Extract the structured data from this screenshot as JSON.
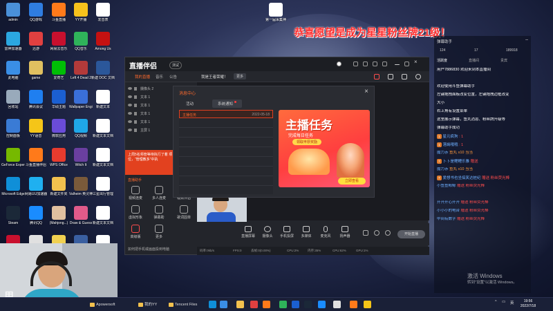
{
  "banner": "恭喜愿望是成为星星粉丝牌21级！",
  "desktop_icons": [
    {
      "label": "admin",
      "color": "#4a90d9"
    },
    {
      "label": "QQ游戏",
      "color": "#2f7de0"
    },
    {
      "label": "斗鱼直播",
      "color": "#ff7a1a"
    },
    {
      "label": "YY开播",
      "color": "#f7c21c"
    },
    {
      "label": "发音表",
      "color": "#ffffff"
    },
    {
      "label": "雷神加速器",
      "color": "#2ba7e0"
    },
    {
      "label": "迅游",
      "color": "#e04040"
    },
    {
      "label": "网易云音乐",
      "color": "#c8102e"
    },
    {
      "label": "QQ音乐",
      "color": "#2fb35a"
    },
    {
      "label": "Among Us",
      "color": "#c51111"
    },
    {
      "label": "此电脑",
      "color": "#3a8ee6"
    },
    {
      "label": "game",
      "color": "#e0c060"
    },
    {
      "label": "爱奇艺",
      "color": "#00be06"
    },
    {
      "label": "Left 4 Dead 2",
      "color": "#b33a3a"
    },
    {
      "label": "新建 DOC 文档",
      "color": "#2b579a"
    },
    {
      "label": "回收站",
      "color": "#9ab"
    },
    {
      "label": "腾讯会议",
      "color": "#1f7ff0"
    },
    {
      "label": "华硕主题",
      "color": "#1b5fd1"
    },
    {
      "label": "Wallpaper Engine",
      "color": "#3a6fd8"
    },
    {
      "label": "新建文本",
      "color": "#ffffff"
    },
    {
      "label": "控制面板",
      "color": "#3a7bd5"
    },
    {
      "label": "YY语音",
      "color": "#f5c518"
    },
    {
      "label": "微软应用",
      "color": "#6a4cd8"
    },
    {
      "label": "QQ视频",
      "color": "#1fa7e8"
    },
    {
      "label": "新建文本文档",
      "color": "#ffffff"
    },
    {
      "label": "GeForce Experience",
      "color": "#76b900"
    },
    {
      "label": "斗鱼直播伴侣",
      "color": "#ff7a1a"
    },
    {
      "label": "WPS Office",
      "color": "#e63b2e"
    },
    {
      "label": "Witch It",
      "color": "#6a3fa0"
    },
    {
      "label": "新建文本文档",
      "color": "#ffffff"
    },
    {
      "label": "Microsoft Edge",
      "color": "#0f8fd8"
    },
    {
      "label": "网易UU加速器",
      "color": "#1fb0f0"
    },
    {
      "label": "新建文件夹",
      "color": "#f2c14e"
    },
    {
      "label": "Valheim 英灵神殿",
      "color": "#7a5a3a"
    },
    {
      "label": "三星出行管理",
      "color": "#ffffff"
    },
    {
      "label": "Steam",
      "color": "#1b2838"
    },
    {
      "label": "腾讯QQ",
      "color": "#1a8cff"
    },
    {
      "label": "(Mahjong...)",
      "color": "#e0c0a0"
    },
    {
      "label": "Draw & Guess",
      "color": "#e05a8a"
    },
    {
      "label": "新建文本文档",
      "color": "#ffffff"
    },
    {
      "label": "网易云",
      "color": "#c8102e"
    },
    {
      "label": "",
      "color": "#e0e0e0"
    },
    {
      "label": "",
      "color": "#f0d050"
    },
    {
      "label": "",
      "color": "#3a5fa0"
    },
    {
      "label": "",
      "color": "#ffffff"
    }
  ],
  "recycle_icon": {
    "label": "第一届采集神",
    "color": "#ffffff"
  },
  "app": {
    "logo": "直播伴侣",
    "logo_badge": "测试",
    "tabs": [
      "我的直播",
      "音乐",
      "公告"
    ],
    "notice": "我是王者荣耀！",
    "notice_btn": "更多",
    "scenes": [
      {
        "label": "摄像头 2"
      },
      {
        "label": "文本 1"
      },
      {
        "label": "文本 1"
      },
      {
        "label": "文本 1"
      },
      {
        "label": "文本 1"
      },
      {
        "label": "主屏 1"
      }
    ],
    "promo_text": "上周5名师管等待执行了着 项位，“管理教多”中执",
    "assist_label": "直播助手",
    "tools": [
      {
        "label": "视频连麦"
      },
      {
        "label": "多人连麦"
      },
      {
        "label": "视频伴侣"
      },
      {
        "label": "虚拟形象"
      },
      {
        "label": "弹幕助"
      },
      {
        "label": "歌词固单"
      },
      {
        "label": "高级版"
      },
      {
        "label": "更多"
      }
    ],
    "collapse_label": "如何把手机或画面投到电脑",
    "controls": [
      {
        "label": "直播屏幕"
      },
      {
        "label": "摄像头"
      },
      {
        "label": "手机投屏"
      },
      {
        "label": "多媒体"
      },
      {
        "label": "麦克风"
      },
      {
        "label": "扬声器"
      }
    ],
    "start_btn": "开始直播",
    "status": [
      "码率:0kb/s",
      "FPS:0",
      "丢帧:0(0.00%)",
      "CPU:2%",
      "内存:35%",
      "CPU:62%",
      "GPU:1%"
    ]
  },
  "dialog": {
    "title": "消息中心",
    "tabs": [
      "活动",
      "系统通知"
    ],
    "messages": [
      {
        "name": "主播任务",
        "date": "2022-05-18"
      },
      {
        "name": "",
        "date": ""
      },
      {
        "name": "",
        "date": ""
      },
      {
        "name": "",
        "date": ""
      },
      {
        "name": "",
        "date": ""
      },
      {
        "name": "",
        "date": ""
      },
      {
        "name": "",
        "date": ""
      },
      {
        "name": "",
        "date": ""
      }
    ],
    "card_title": "主播任务",
    "card_sub": "完成每日任务",
    "card_pill": "领取丰厚奖励",
    "card_btn": "立即查看"
  },
  "chat": {
    "header": "弹幕助手",
    "stats": [
      "124",
      "17",
      "189918"
    ],
    "tabs": [
      "活跃度",
      "直播间",
      "贵宾"
    ],
    "lines": [
      {
        "badge": "",
        "user": "",
        "text": "用户7886830 欢迎来到本直播间",
        "cls": "u-white"
      },
      {
        "badge": "",
        "user": "",
        "text": "",
        "cls": "u-white"
      },
      {
        "badge": "",
        "user": "",
        "text": "欢迎使用斗鱼弹幕助手",
        "cls": "u-white"
      },
      {
        "badge": "",
        "user": "",
        "text": "左键拖拽面板改变位置，左键拖拽边框改变",
        "cls": "u-white"
      },
      {
        "badge": "",
        "user": "",
        "text": "大小",
        "cls": "u-white"
      },
      {
        "badge": "",
        "user": "",
        "text": "右上角有设置菜单",
        "cls": "u-white"
      },
      {
        "badge": "",
        "user": "",
        "text": "这里展示弹幕，鱼丸消息、粉丝牌升级等",
        "cls": "u-white"
      },
      {
        "badge": "",
        "user": "",
        "text": "弹幕助手成功",
        "cls": "u-white"
      },
      {
        "badge": "1",
        "user": "星元疯狗",
        "text": ": 1",
        "cls": "u-red"
      },
      {
        "badge": "1",
        "user": "落嫣哦哦",
        "text": ": 1",
        "cls": "u-red"
      },
      {
        "badge": "",
        "user": "魔力赤",
        "text": "鱼丸 x10 当当",
        "cls": "u-orange"
      },
      {
        "badge": "7",
        "user": "卜卜是鲤鲤乐雅",
        "text": "赠送",
        "cls": "u-red"
      },
      {
        "badge": "",
        "user": "魔力赤",
        "text": "鱼丸 x10 当当",
        "cls": "u-orange"
      },
      {
        "badge": "7",
        "user": "爱想书也坐搞笑达桩纪",
        "text": "赠送 粉丝荧光棒",
        "cls": "u-red"
      },
      {
        "badge": "",
        "user": "小鱼鱼鲸鲸",
        "text": "赠送 粉丝荧光棒",
        "cls": "u-red"
      },
      {
        "badge": "",
        "user": "",
        "text": "",
        "cls": "u-white"
      },
      {
        "badge": "",
        "user": "开开开心开开",
        "text": "赠送 粉丝荧光棒",
        "cls": "u-red"
      },
      {
        "badge": "",
        "user": "小小小的电台",
        "text": "赠送 粉丝荧光棒",
        "cls": "u-red"
      },
      {
        "badge": "",
        "user": "中间有数字",
        "text": "赠送 粉丝荧光棒",
        "cls": "u-red"
      }
    ]
  },
  "webcam": {
    "label": "用",
    "id": "3291523"
  },
  "activate": {
    "title": "激活 Windows",
    "sub": "转到\"设置\"以激活 Windows。"
  },
  "taskbar": {
    "items": [
      {
        "label": "Apowersoft"
      },
      {
        "label": "我的YY"
      },
      {
        "label": "Tencent Files"
      }
    ],
    "tray_lang": "英",
    "time": "19:56",
    "date": "2022/7/18"
  }
}
